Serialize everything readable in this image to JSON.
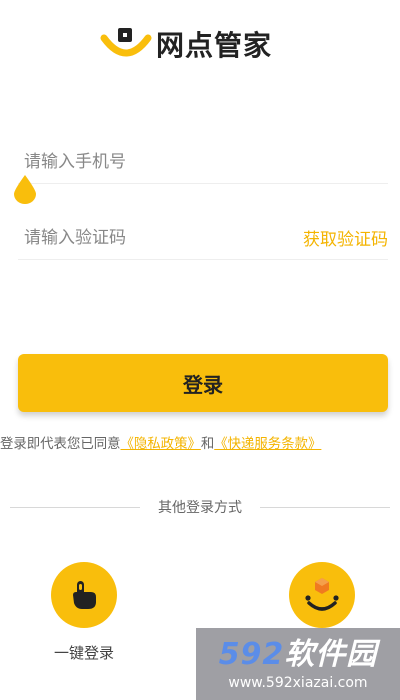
{
  "app": {
    "title": "网点管家"
  },
  "form": {
    "phone_placeholder": "请输入手机号",
    "code_placeholder": "请输入验证码",
    "get_code_label": "获取验证码",
    "login_label": "登录"
  },
  "agreement": {
    "prefix": "登录即代表您已同意",
    "privacy_link": "《隐私政策》",
    "connector": "和",
    "terms_link": "《快递服务条款》"
  },
  "other_login": {
    "title": "其他登录方式",
    "one_key_label": "一键登录"
  },
  "watermark": {
    "brand_num": "592",
    "brand_text": "软件园",
    "url": "www.592xiazai.com"
  },
  "colors": {
    "accent": "#f9be0c",
    "link": "#f4b400"
  },
  "icons": {
    "logo": "coin-smile-logo-icon",
    "one_key": "tap-finger-icon",
    "app_login": "smile-box-icon"
  }
}
